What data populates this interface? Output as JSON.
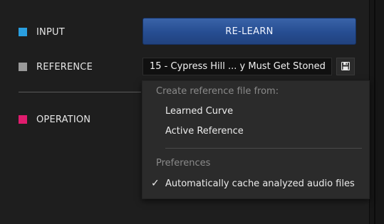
{
  "rows": {
    "input": {
      "label": "INPUT",
      "color": "#2a9fe0"
    },
    "reference": {
      "label": "REFERENCE",
      "color": "#9a9a9a"
    },
    "operation": {
      "label": "OPERATION",
      "color": "#e01c6e"
    }
  },
  "relearn_button": {
    "label": "RE-LEARN"
  },
  "reference_field": {
    "value": "15 - Cypress Hill ... y Must Get Stoned"
  },
  "save_button": {
    "icon": "floppy-disk-icon"
  },
  "menu": {
    "header_create": "Create reference file from:",
    "items": [
      "Learned Curve",
      "Active Reference"
    ],
    "header_preferences": "Preferences",
    "check_glyph": "✓",
    "checked_item": "Automatically cache analyzed audio files"
  }
}
